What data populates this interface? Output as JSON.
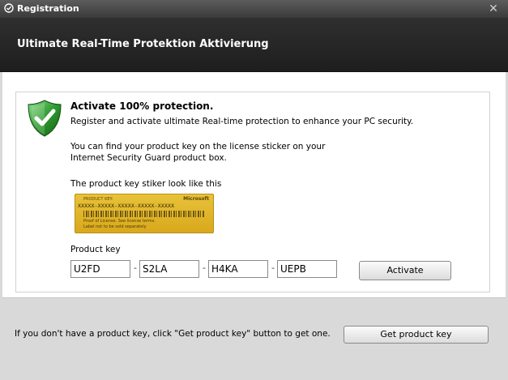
{
  "window": {
    "title": "Registration",
    "close_glyph": "✕"
  },
  "header": {
    "title": "Ultimate Real-Time Protektion Aktivierung"
  },
  "panel": {
    "heading": "Activate 100% protection.",
    "description": "Register and activate ultimate Real-time protection to enhance your PC security.",
    "find_key_line1": "You can find your product key on the license sticker on your",
    "find_key_line2": "Internet Security Guard product box.",
    "sticker_caption": "The product key stiker look like this",
    "sticker": {
      "label": "PRODUCT KEY:",
      "brand": "Microsoft",
      "key_placeholder": "XXXXX-XXXXX-XXXXX-XXXXX-XXXXX",
      "small_text1": "Proof of License. See license terms.",
      "small_text2": "Label not to be sold separately"
    },
    "product_key_label": "Product key",
    "key_separator": "-",
    "key_parts": [
      "U2FD",
      "S2LA",
      "H4KA",
      "UEPB"
    ],
    "activate_label": "Activate"
  },
  "footer": {
    "hint": "If you don't have a product key, click \"Get product key\" button to get one.",
    "get_key_label": "Get product key"
  },
  "icons": {
    "title": "registration-app-icon",
    "shield": "shield-check-icon",
    "close": "close-icon"
  },
  "colors": {
    "titlebar": "#3a3a3a",
    "header": "#1e1e1e",
    "shield_green": "#2e9a2e",
    "sticker_gold": "#e2b82c"
  }
}
